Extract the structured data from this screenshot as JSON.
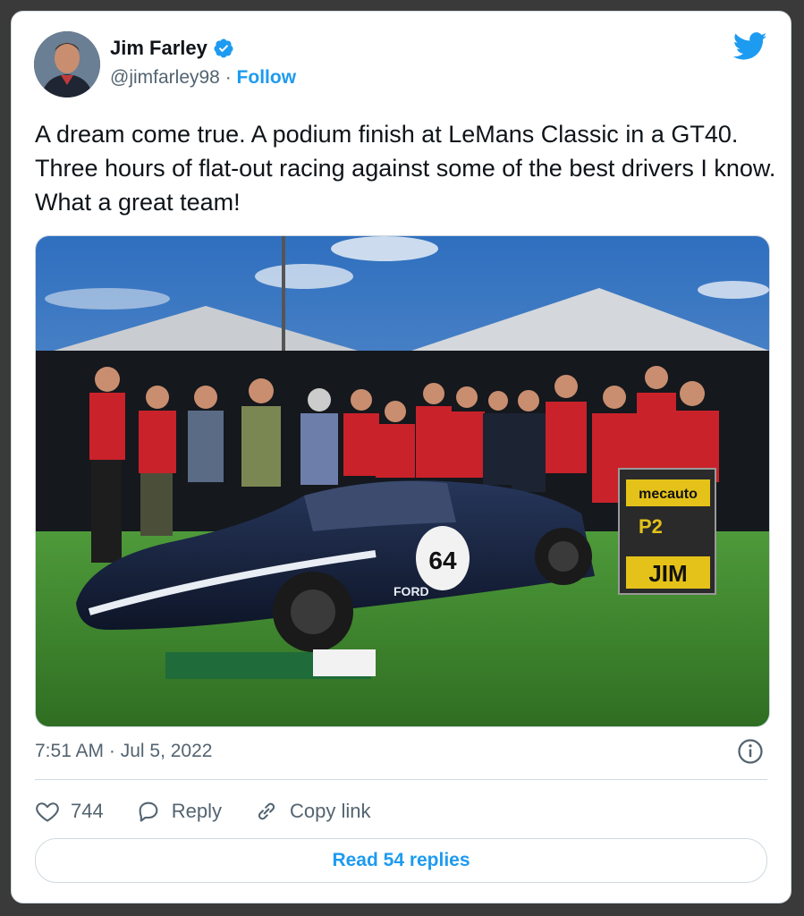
{
  "author": {
    "name": "Jim Farley",
    "handle": "@jimfarley98",
    "separator": "·",
    "follow_label": "Follow",
    "verified": true
  },
  "tweet": {
    "text": "A dream come true.  A podium finish at LeMans Classic in a GT40. Three hours of flat-out racing against some of the best drivers I know. What a great team!",
    "timestamp": "7:51 AM · Jul 5, 2022"
  },
  "photo": {
    "sign_brand": "mecauto",
    "sign_position": "P2",
    "sign_name": "JIM",
    "car_number": "64",
    "car_brand": "FORD"
  },
  "actions": {
    "likes": "744",
    "reply_label": "Reply",
    "copy_link_label": "Copy link"
  },
  "read_replies_label": "Read 54 replies",
  "colors": {
    "accent": "#1d9bf0",
    "text": "#0f1419",
    "secondary": "#536471",
    "border": "#cfd9de"
  },
  "icons": [
    "twitter-bird-icon",
    "verified-badge-icon",
    "info-icon",
    "heart-icon",
    "reply-bubble-icon",
    "link-icon"
  ]
}
